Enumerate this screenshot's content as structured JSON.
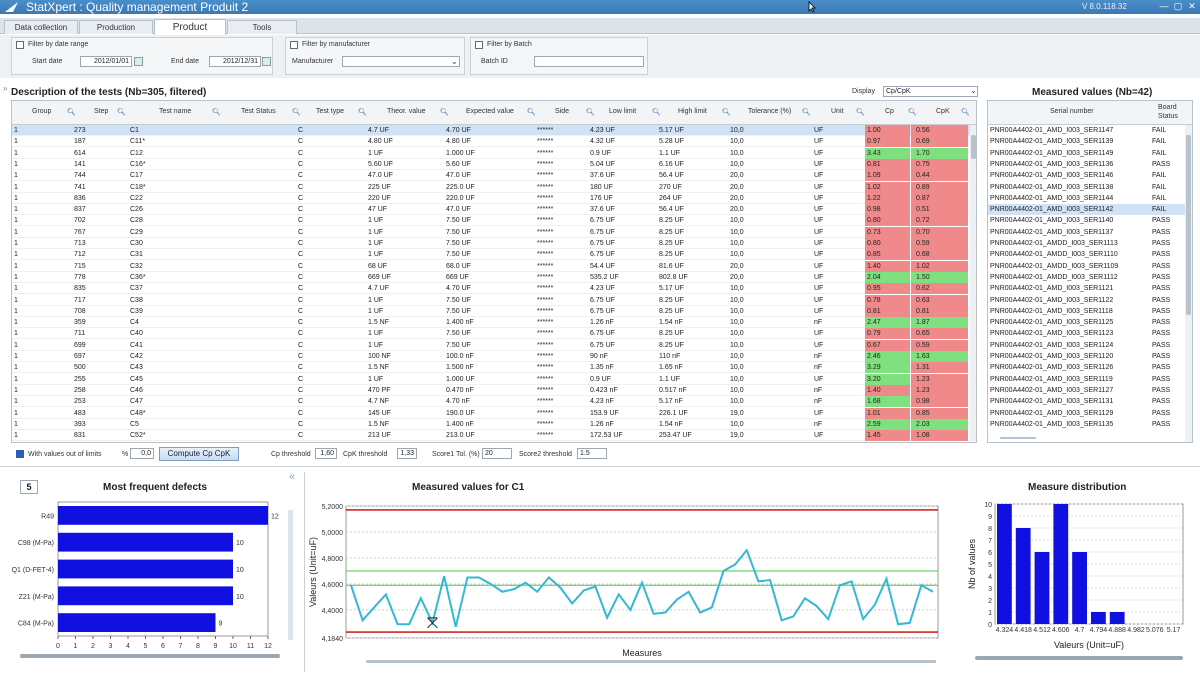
{
  "app": {
    "title": "StatXpert : Quality management  Produit 2",
    "version": "V 8.0.118.32"
  },
  "window_buttons": [
    "—",
    "▢",
    "✕"
  ],
  "tabs": [
    {
      "label": "Data collection"
    },
    {
      "label": "Production"
    },
    {
      "label": "Product"
    },
    {
      "label": "Tools"
    }
  ],
  "filters": {
    "date": {
      "label": "Filter by date range",
      "start_label": "Start date",
      "start_value": "2012/01/01",
      "end_label": "End date",
      "end_value": "2012/12/31"
    },
    "manufacturer": {
      "label": "Filter by manufacturer",
      "field_label": "Manufacturer",
      "value": ""
    },
    "batch": {
      "label": "Filter by Batch",
      "field_label": "Batch ID",
      "value": ""
    }
  },
  "tests": {
    "title": "Description of the tests (Nb=305, filtered)",
    "display_label": "Display",
    "display_value": "Cp/CpK",
    "columns": [
      "Group",
      "Step",
      "Test name",
      "Test Status",
      "Test type",
      "Theor. value",
      "Expected value",
      "Side",
      "Low limit",
      "High limit",
      "Tolerance (%)",
      "Unit",
      "Cp",
      "CpK"
    ],
    "rows": [
      {
        "group": "1",
        "step": "273",
        "name": "C1",
        "type": "C",
        "theor": "4.7 UF",
        "expected": "4.70 UF",
        "side": "******",
        "low": "4.23 UF",
        "high": "5.17 UF",
        "tol": "10,0",
        "unit": "UF",
        "cp": "1.00",
        "cpk": "0.56",
        "cpc": "red",
        "cpkc": "red",
        "sel": true
      },
      {
        "group": "1",
        "step": "187",
        "name": "C11*",
        "type": "C",
        "theor": "4.80 UF",
        "expected": "4.80 UF",
        "side": "******",
        "low": "4.32 UF",
        "high": "5.28 UF",
        "tol": "10,0",
        "unit": "UF",
        "cp": "0.97",
        "cpk": "0.69",
        "cpc": "red",
        "cpkc": "red"
      },
      {
        "group": "1",
        "step": "614",
        "name": "C12",
        "type": "C",
        "theor": "1 UF",
        "expected": "1.000 UF",
        "side": "******",
        "low": "0.9 UF",
        "high": "1.1 UF",
        "tol": "10,0",
        "unit": "UF",
        "cp": "3.43",
        "cpk": "1.70",
        "cpc": "green",
        "cpkc": "green"
      },
      {
        "group": "1",
        "step": "141",
        "name": "C16*",
        "type": "C",
        "theor": "5.60 UF",
        "expected": "5.60 UF",
        "side": "******",
        "low": "5.04 UF",
        "high": "6.16 UF",
        "tol": "10,0",
        "unit": "UF",
        "cp": "0.81",
        "cpk": "0.75",
        "cpc": "red",
        "cpkc": "red"
      },
      {
        "group": "1",
        "step": "744",
        "name": "C17",
        "type": "C",
        "theor": "47.0 UF",
        "expected": "47.0 UF",
        "side": "******",
        "low": "37.6 UF",
        "high": "56.4 UF",
        "tol": "20,0",
        "unit": "UF",
        "cp": "1.09",
        "cpk": "0.44",
        "cpc": "red",
        "cpkc": "red"
      },
      {
        "group": "1",
        "step": "741",
        "name": "C18*",
        "type": "C",
        "theor": "225 UF",
        "expected": "225.0 UF",
        "side": "******",
        "low": "180 UF",
        "high": "270 UF",
        "tol": "20,0",
        "unit": "UF",
        "cp": "1.02",
        "cpk": "0.89",
        "cpc": "red",
        "cpkc": "red"
      },
      {
        "group": "1",
        "step": "836",
        "name": "C22",
        "type": "C",
        "theor": "220 UF",
        "expected": "220.0 UF",
        "side": "******",
        "low": "176 UF",
        "high": "264 UF",
        "tol": "20,0",
        "unit": "UF",
        "cp": "1.22",
        "cpk": "0.87",
        "cpc": "red",
        "cpkc": "red"
      },
      {
        "group": "1",
        "step": "837",
        "name": "C26",
        "type": "C",
        "theor": "47 UF",
        "expected": "47.0 UF",
        "side": "******",
        "low": "37.6 UF",
        "high": "56.4 UF",
        "tol": "20,0",
        "unit": "UF",
        "cp": "0.98",
        "cpk": "0.51",
        "cpc": "red",
        "cpkc": "red"
      },
      {
        "group": "1",
        "step": "702",
        "name": "C28",
        "type": "C",
        "theor": "1 UF",
        "expected": "7.50 UF",
        "side": "******",
        "low": "6.75 UF",
        "high": "8.25 UF",
        "tol": "10,0",
        "unit": "UF",
        "cp": "0.80",
        "cpk": "0.72",
        "cpc": "red",
        "cpkc": "red"
      },
      {
        "group": "1",
        "step": "767",
        "name": "C29",
        "type": "C",
        "theor": "1 UF",
        "expected": "7.50 UF",
        "side": "******",
        "low": "6.75 UF",
        "high": "8.25 UF",
        "tol": "10,0",
        "unit": "UF",
        "cp": "0.73",
        "cpk": "0.70",
        "cpc": "red",
        "cpkc": "red"
      },
      {
        "group": "1",
        "step": "713",
        "name": "C30",
        "type": "C",
        "theor": "1 UF",
        "expected": "7.50 UF",
        "side": "******",
        "low": "6.75 UF",
        "high": "8.25 UF",
        "tol": "10,0",
        "unit": "UF",
        "cp": "0.80",
        "cpk": "0.59",
        "cpc": "red",
        "cpkc": "red"
      },
      {
        "group": "1",
        "step": "712",
        "name": "C31",
        "type": "C",
        "theor": "1 UF",
        "expected": "7.50 UF",
        "side": "******",
        "low": "6.75 UF",
        "high": "8.25 UF",
        "tol": "10,0",
        "unit": "UF",
        "cp": "0.85",
        "cpk": "0.68",
        "cpc": "red",
        "cpkc": "red"
      },
      {
        "group": "1",
        "step": "715",
        "name": "C32",
        "type": "C",
        "theor": "68 UF",
        "expected": "68.0 UF",
        "side": "******",
        "low": "54.4 UF",
        "high": "81.6 UF",
        "tol": "20,0",
        "unit": "UF",
        "cp": "1.40",
        "cpk": "1.02",
        "cpc": "red",
        "cpkc": "red"
      },
      {
        "group": "1",
        "step": "778",
        "name": "C36*",
        "type": "C",
        "theor": "669 UF",
        "expected": "669 UF",
        "side": "******",
        "low": "535.2 UF",
        "high": "802.8 UF",
        "tol": "20,0",
        "unit": "UF",
        "cp": "2.04",
        "cpk": "1.50",
        "cpc": "green",
        "cpkc": "green"
      },
      {
        "group": "1",
        "step": "835",
        "name": "C37",
        "type": "C",
        "theor": "4.7 UF",
        "expected": "4.70 UF",
        "side": "******",
        "low": "4.23 UF",
        "high": "5.17 UF",
        "tol": "10,0",
        "unit": "UF",
        "cp": "0.95",
        "cpk": "0.62",
        "cpc": "red",
        "cpkc": "red"
      },
      {
        "group": "1",
        "step": "717",
        "name": "C38",
        "type": "C",
        "theor": "1 UF",
        "expected": "7.50 UF",
        "side": "******",
        "low": "6.75 UF",
        "high": "8.25 UF",
        "tol": "10,0",
        "unit": "UF",
        "cp": "0.78",
        "cpk": "0.63",
        "cpc": "red",
        "cpkc": "red"
      },
      {
        "group": "1",
        "step": "708",
        "name": "C39",
        "type": "C",
        "theor": "1 UF",
        "expected": "7.50 UF",
        "side": "******",
        "low": "6.75 UF",
        "high": "8.25 UF",
        "tol": "10,0",
        "unit": "UF",
        "cp": "0.81",
        "cpk": "0.81",
        "cpc": "red",
        "cpkc": "red"
      },
      {
        "group": "1",
        "step": "359",
        "name": "C4",
        "type": "C",
        "theor": "1.5 NF",
        "expected": "1.400 nF",
        "side": "******",
        "low": "1.26 nF",
        "high": "1.54 nF",
        "tol": "10,0",
        "unit": "nF",
        "cp": "2.47",
        "cpk": "1.87",
        "cpc": "green",
        "cpkc": "green"
      },
      {
        "group": "1",
        "step": "711",
        "name": "C40",
        "type": "C",
        "theor": "1 UF",
        "expected": "7.50 UF",
        "side": "******",
        "low": "6.75 UF",
        "high": "8.25 UF",
        "tol": "10,0",
        "unit": "UF",
        "cp": "0.79",
        "cpk": "0.65",
        "cpc": "red",
        "cpkc": "red"
      },
      {
        "group": "1",
        "step": "699",
        "name": "C41",
        "type": "C",
        "theor": "1 UF",
        "expected": "7.50 UF",
        "side": "******",
        "low": "6.75 UF",
        "high": "8.25 UF",
        "tol": "10,0",
        "unit": "UF",
        "cp": "0.67",
        "cpk": "0.59",
        "cpc": "red",
        "cpkc": "red"
      },
      {
        "group": "1",
        "step": "697",
        "name": "C42",
        "type": "C",
        "theor": "100 NF",
        "expected": "100.0 nF",
        "side": "******",
        "low": "90 nF",
        "high": "110 nF",
        "tol": "10,0",
        "unit": "nF",
        "cp": "2.46",
        "cpk": "1.63",
        "cpc": "green",
        "cpkc": "green"
      },
      {
        "group": "1",
        "step": "500",
        "name": "C43",
        "type": "C",
        "theor": "1.5 NF",
        "expected": "1.500 nF",
        "side": "******",
        "low": "1.35 nF",
        "high": "1.65 nF",
        "tol": "10,0",
        "unit": "nF",
        "cp": "3.29",
        "cpk": "1.31",
        "cpc": "green",
        "cpkc": "red"
      },
      {
        "group": "1",
        "step": "255",
        "name": "C45",
        "type": "C",
        "theor": "1 UF",
        "expected": "1.000 UF",
        "side": "******",
        "low": "0.9 UF",
        "high": "1.1 UF",
        "tol": "10,0",
        "unit": "UF",
        "cp": "3.20",
        "cpk": "1.23",
        "cpc": "green",
        "cpkc": "red"
      },
      {
        "group": "1",
        "step": "258",
        "name": "C46",
        "type": "C",
        "theor": "470 PF",
        "expected": "0.470 nF",
        "side": "******",
        "low": "0.423 nF",
        "high": "0.517 nF",
        "tol": "10,0",
        "unit": "nF",
        "cp": "1.40",
        "cpk": "1.23",
        "cpc": "red",
        "cpkc": "red"
      },
      {
        "group": "1",
        "step": "253",
        "name": "C47",
        "type": "C",
        "theor": "4.7 NF",
        "expected": "4.70 nF",
        "side": "******",
        "low": "4.23 nF",
        "high": "5.17 nF",
        "tol": "10,0",
        "unit": "nF",
        "cp": "1.68",
        "cpk": "0.98",
        "cpc": "green",
        "cpkc": "red"
      },
      {
        "group": "1",
        "step": "483",
        "name": "C48*",
        "type": "C",
        "theor": "145 UF",
        "expected": "190.0 UF",
        "side": "******",
        "low": "153.9 UF",
        "high": "226.1 UF",
        "tol": "19,0",
        "unit": "UF",
        "cp": "1.01",
        "cpk": "0.85",
        "cpc": "red",
        "cpkc": "red"
      },
      {
        "group": "1",
        "step": "393",
        "name": "C5",
        "type": "C",
        "theor": "1.5 NF",
        "expected": "1.400 nF",
        "side": "******",
        "low": "1.26 nF",
        "high": "1.54 nF",
        "tol": "10,0",
        "unit": "nF",
        "cp": "2.59",
        "cpk": "2.03",
        "cpc": "green",
        "cpkc": "green"
      },
      {
        "group": "1",
        "step": "831",
        "name": "C52*",
        "type": "C",
        "theor": "213 UF",
        "expected": "213.0 UF",
        "side": "******",
        "low": "172.53 UF",
        "high": "253.47 UF",
        "tol": "19,0",
        "unit": "UF",
        "cp": "1.45",
        "cpk": "1.08",
        "cpc": "red",
        "cpkc": "red"
      }
    ]
  },
  "controls": {
    "out_of_limits": "With values out of limits",
    "pct_label": "%",
    "pct_value": "0,0",
    "compute_button": "Compute Cp CpK",
    "cp_threshold_label": "Cp threshold",
    "cp_threshold": "1,60",
    "cpk_threshold_label": "CpK threshold",
    "cpk_threshold": "1,33",
    "score1_label": "Score1 Tol. (%)",
    "score1": "20",
    "score2_label": "Score2 threshold",
    "score2": "1.5"
  },
  "measured": {
    "title": "Measured values (Nb=42)",
    "columns": [
      "Serial number",
      "Board Status"
    ],
    "rows": [
      {
        "sn": "PNR00A4402-01_AMD_I003_SER1147",
        "st": "FAIL"
      },
      {
        "sn": "PNR00A4402-01_AMD_I003_SER1139",
        "st": "FAIL"
      },
      {
        "sn": "PNR00A4402-01_AMD_I003_SER1149",
        "st": "FAIL"
      },
      {
        "sn": "PNR00A4402-01_AMD_I003_SER1136",
        "st": "PASS"
      },
      {
        "sn": "PNR00A4402-01_AMD_I003_SER1146",
        "st": "FAIL"
      },
      {
        "sn": "PNR00A4402-01_AMD_I003_SER1138",
        "st": "FAIL"
      },
      {
        "sn": "PNR00A4402-01_AMD_I003_SER1144",
        "st": "FAIL"
      },
      {
        "sn": "PNR00A4402-01_AMD_I003_SER1142",
        "st": "FAIL",
        "sel": true
      },
      {
        "sn": "PNR00A4402-01_AMD_I003_SER1140",
        "st": "PASS"
      },
      {
        "sn": "PNR00A4402-01_AMD_I003_SER1137",
        "st": "PASS"
      },
      {
        "sn": "PNR00A4402-01_AMDD_I003_SER1113",
        "st": "PASS"
      },
      {
        "sn": "PNR00A4402-01_AMDD_I003_SER1110",
        "st": "PASS"
      },
      {
        "sn": "PNR00A4402-01_AMDD_I003_SER1109",
        "st": "PASS"
      },
      {
        "sn": "PNR00A4402-01_AMDD_I003_SER1112",
        "st": "PASS"
      },
      {
        "sn": "PNR00A4402-01_AMD_I003_SER1121",
        "st": "PASS"
      },
      {
        "sn": "PNR00A4402-01_AMD_I003_SER1122",
        "st": "PASS"
      },
      {
        "sn": "PNR00A4402-01_AMD_I003_SER1118",
        "st": "PASS"
      },
      {
        "sn": "PNR00A4402-01_AMD_I003_SER1125",
        "st": "PASS"
      },
      {
        "sn": "PNR00A4402-01_AMD_I003_SER1123",
        "st": "PASS"
      },
      {
        "sn": "PNR00A4402-01_AMD_I003_SER1124",
        "st": "PASS"
      },
      {
        "sn": "PNR00A4402-01_AMD_I003_SER1120",
        "st": "PASS"
      },
      {
        "sn": "PNR00A4402-01_AMD_I003_SER1126",
        "st": "PASS"
      },
      {
        "sn": "PNR00A4402-01_AMD_I003_SER1119",
        "st": "PASS"
      },
      {
        "sn": "PNR00A4402-01_AMD_I003_SER1127",
        "st": "PASS"
      },
      {
        "sn": "PNR00A4402-01_AMD_I003_SER1131",
        "st": "PASS"
      },
      {
        "sn": "PNR00A4402-01_AMD_I003_SER1129",
        "st": "PASS"
      },
      {
        "sn": "PNR00A4402-01_AMD_I003_SER1135",
        "st": "PASS"
      }
    ]
  },
  "defects": {
    "count": "5",
    "title": "Most frequent defects"
  },
  "line_chart": {
    "title": "Measured values for C1"
  },
  "dist_chart": {
    "title": "Measure distribution"
  },
  "chart_data": [
    {
      "type": "bar",
      "orientation": "horizontal",
      "title": "Most frequent defects",
      "categories": [
        "R49",
        "C98 (M-Pa)",
        "Q1 (D-FET-4)",
        "Z21 (M-Pa)",
        "C84 (M-Pa)"
      ],
      "values": [
        12,
        10,
        10,
        10,
        9
      ],
      "xticks": [
        "0",
        "1",
        "2",
        "3",
        "4",
        "5",
        "6",
        "7",
        "8",
        "9",
        "10",
        "11",
        "12"
      ],
      "xlim": [
        0,
        12
      ],
      "color": "#1010e0"
    },
    {
      "type": "line",
      "title": "Measured values for C1",
      "xlabel": "Measures",
      "ylabel": "Valeurs (Unit=uF)",
      "yticks": [
        "5,2000",
        "5,0000",
        "4,8000",
        "4,6000",
        "4,4000",
        "4,1840"
      ],
      "ylim": [
        4.184,
        5.2
      ],
      "lines": {
        "usl": 5.17,
        "lsl": 4.23,
        "upper_green": 4.7,
        "lower_green": 4.59
      },
      "values": [
        4.59,
        4.32,
        4.42,
        4.52,
        4.29,
        4.29,
        4.49,
        4.3,
        4.66,
        4.27,
        4.65,
        4.65,
        4.6,
        4.54,
        4.56,
        4.61,
        4.54,
        4.65,
        4.57,
        4.45,
        4.55,
        4.58,
        4.34,
        4.52,
        4.4,
        4.61,
        4.37,
        4.38,
        4.48,
        4.54,
        4.38,
        4.42,
        4.7,
        4.75,
        4.86,
        4.62,
        4.63,
        4.32,
        4.35,
        4.49,
        4.43,
        4.33,
        4.59,
        4.62,
        4.33,
        4.44,
        4.64,
        4.29,
        4.3,
        4.59,
        4.54
      ],
      "line_color": "#33b8d6"
    },
    {
      "type": "bar",
      "title": "Measure distribution",
      "xlabel": "Valeurs (Unit=uF)",
      "ylabel": "Nb of values",
      "categories": [
        "4.324",
        "4.418",
        "4.512",
        "4.606",
        "4.7",
        "4.794",
        "4.888",
        "4.982",
        "5.076",
        "5.17"
      ],
      "values": [
        10,
        8,
        6,
        10,
        6,
        1,
        1,
        0,
        0,
        0
      ],
      "yticks": [
        "0",
        "1",
        "2",
        "3",
        "4",
        "5",
        "6",
        "7",
        "8",
        "9",
        "10"
      ],
      "ylim": [
        0,
        10
      ],
      "color": "#1010e0"
    }
  ]
}
